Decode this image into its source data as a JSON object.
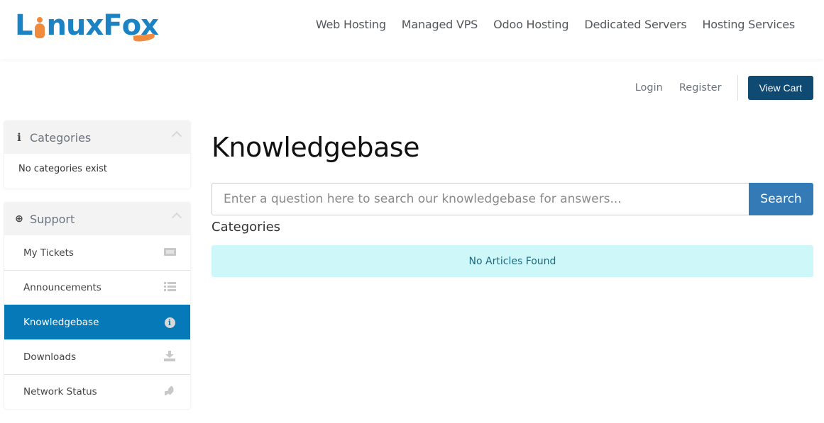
{
  "brand": {
    "name_part1": "L",
    "name_part2": "nux",
    "name_part3": "F",
    "name_part4": "o",
    "name_part5": "x",
    "primary_color": "#1b83c4",
    "accent_color": "#f08a3c"
  },
  "topnav": {
    "items": [
      {
        "label": "Web Hosting"
      },
      {
        "label": "Managed VPS"
      },
      {
        "label": "Odoo Hosting"
      },
      {
        "label": "Dedicated Servers"
      },
      {
        "label": "Hosting Services"
      }
    ]
  },
  "account_bar": {
    "login_label": "Login",
    "register_label": "Register",
    "cart_label": "View Cart"
  },
  "sidebar": {
    "categories_panel": {
      "title": "Categories",
      "icon": "info-icon",
      "empty_text": "No categories exist"
    },
    "support_panel": {
      "title": "Support",
      "icon": "life-ring-icon",
      "items": [
        {
          "label": "My Tickets",
          "icon": "ticket-icon",
          "active": false
        },
        {
          "label": "Announcements",
          "icon": "list-icon",
          "active": false
        },
        {
          "label": "Knowledgebase",
          "icon": "info-circle-icon",
          "active": true
        },
        {
          "label": "Downloads",
          "icon": "download-icon",
          "active": false
        },
        {
          "label": "Network Status",
          "icon": "rocket-icon",
          "active": false
        }
      ]
    }
  },
  "main": {
    "title": "Knowledgebase",
    "search": {
      "placeholder": "Enter a question here to search our knowledgebase for answers...",
      "value": "",
      "button_label": "Search"
    },
    "categories_heading": "Categories",
    "empty_alert": "No Articles Found"
  },
  "colors": {
    "active_item": "#0679b8",
    "cart_button": "#0f4a72",
    "search_button": "#337ab7",
    "alert_bg": "#cef7fa"
  }
}
